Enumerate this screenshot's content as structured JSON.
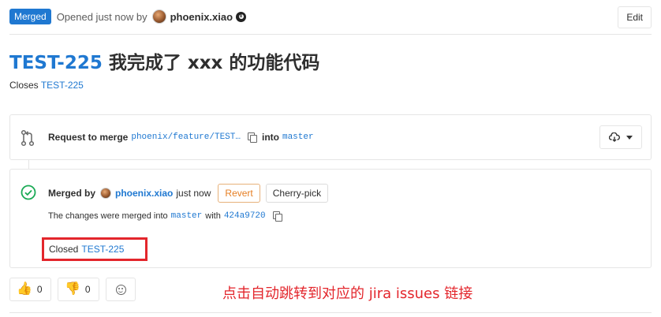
{
  "header": {
    "status_badge": "Merged",
    "opened_text": "Opened just now by",
    "author": "phoenix.xiao",
    "edit_label": "Edit"
  },
  "issue": {
    "key": "TEST-225",
    "title_text": "我完成了 xxx 的功能代码",
    "closes_label": "Closes",
    "closes_link": "TEST-225"
  },
  "request": {
    "label": "Request to merge",
    "source_branch": "phoenix/feature/TEST…",
    "into_label": "into",
    "target_branch": "master"
  },
  "merged": {
    "label": "Merged by",
    "author": "phoenix.xiao",
    "time": "just now",
    "revert_label": "Revert",
    "cherry_pick_label": "Cherry-pick",
    "changes_prefix": "The changes were merged into",
    "target_branch": "master",
    "with_label": "with",
    "commit": "424a9720",
    "closed_label": "Closed",
    "closed_link": "TEST-225"
  },
  "awards": {
    "thumbs_up_count": "0",
    "thumbs_down_count": "0"
  },
  "annotation": "点击自动跳转到对应的 jira issues 链接",
  "colors": {
    "link": "#1f78d1",
    "merged_badge": "#1f78d1",
    "revert": "#e67e22",
    "success": "#1aaa55",
    "annotation": "#e3262c"
  },
  "icons": [
    "avatar",
    "eight-ball-icon",
    "branch-icon",
    "copy-icon",
    "download-icon",
    "chevron-down-icon",
    "check-circle-icon",
    "thumbs-up-icon",
    "thumbs-down-icon",
    "smiley-icon"
  ]
}
